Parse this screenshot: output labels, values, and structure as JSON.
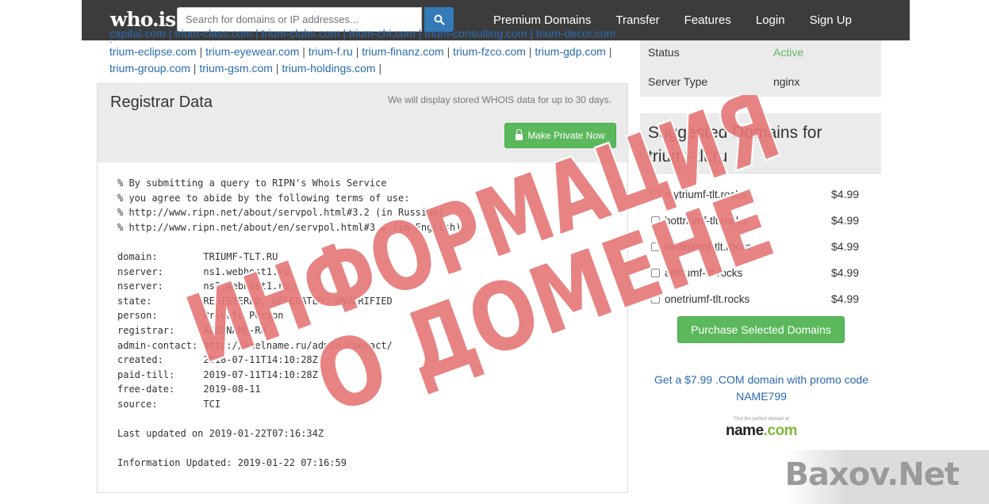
{
  "nav": {
    "logo": "who.is",
    "search_placeholder": "Search for domains or IP addresses...",
    "links": [
      "Premium Domains",
      "Transfer",
      "Features",
      "Login",
      "Sign Up"
    ]
  },
  "related_domains": {
    "cut_line": "capital.com | trium-class.com | trium-clubs.com | trium-chi.com | trium-consulting.com | trium-decor.com |",
    "items": [
      "trium-eclipse.com",
      "trium-eyewear.com",
      "trium-f.ru",
      "trium-finanz.com",
      "trium-fzco.com",
      "trium-gdp.com",
      "trium-group.com",
      "trium-gsm.com",
      "trium-holdings.com"
    ]
  },
  "registrar": {
    "title": "Registrar Data",
    "note": "We will display stored WHOIS data for up to 30 days.",
    "private_button": "Make Private Now",
    "whois_text": "% By submitting a query to RIPN's Whois Service\n% you agree to abide by the following terms of use:\n% http://www.ripn.net/about/servpol.html#3.2 (in Russian)\n% http://www.ripn.net/about/en/servpol.html#3.2 (in English).\n\ndomain:        TRIUMF-TLT.RU\nnserver:       ns1.webhost1.ru.\nnserver:       ns2.webhost1.ru.\nstate:         REGISTERED, DELEGATED, UNVERIFIED\nperson:        Private Person\nregistrar:     AXELNAME-RU\nadmin-contact: http://axelname.ru/admin-contact/\ncreated:       2018-07-11T14:10:28Z\npaid-till:     2019-07-11T14:10:28Z\nfree-date:     2019-08-11\nsource:        TCI\n\nLast updated on 2019-01-22T07:16:34Z\n\nInformation Updated: 2019-01-22 07:16:59"
  },
  "status": {
    "status_label": "Status",
    "status_value": "Active",
    "server_label": "Server Type",
    "server_value": "nginx",
    "active_color": "#5cb85c"
  },
  "suggested": {
    "title_line1": "Suggested Domains for",
    "title_line2": "triumf-tlt.ru",
    "items": [
      {
        "name": "mytriumf-tlt.rocks",
        "price": "$4.99"
      },
      {
        "name": "hottriumf-tlt.rocks",
        "price": "$4.99"
      },
      {
        "name": "newtriumf-tlt.rocks",
        "price": "$4.99"
      },
      {
        "name": "alltriumf-tlt.rocks",
        "price": "$4.99"
      },
      {
        "name": "onetriumf-tlt.rocks",
        "price": "$4.99"
      }
    ],
    "purchase_button": "Purchase Selected Domains"
  },
  "promo": {
    "text_line1": "Get a $7.99 .COM domain with promo code",
    "text_line2": "NAME799",
    "tagline": "Find the perfect domain at",
    "brand_name": "name",
    "brand_tld": ".com"
  },
  "overlay": {
    "line1": "ИНФОРМАЦИЯ",
    "line2": "О ДОМЕНЕ",
    "color": "#e07070"
  },
  "watermark": {
    "text": "Baxov.Net"
  }
}
